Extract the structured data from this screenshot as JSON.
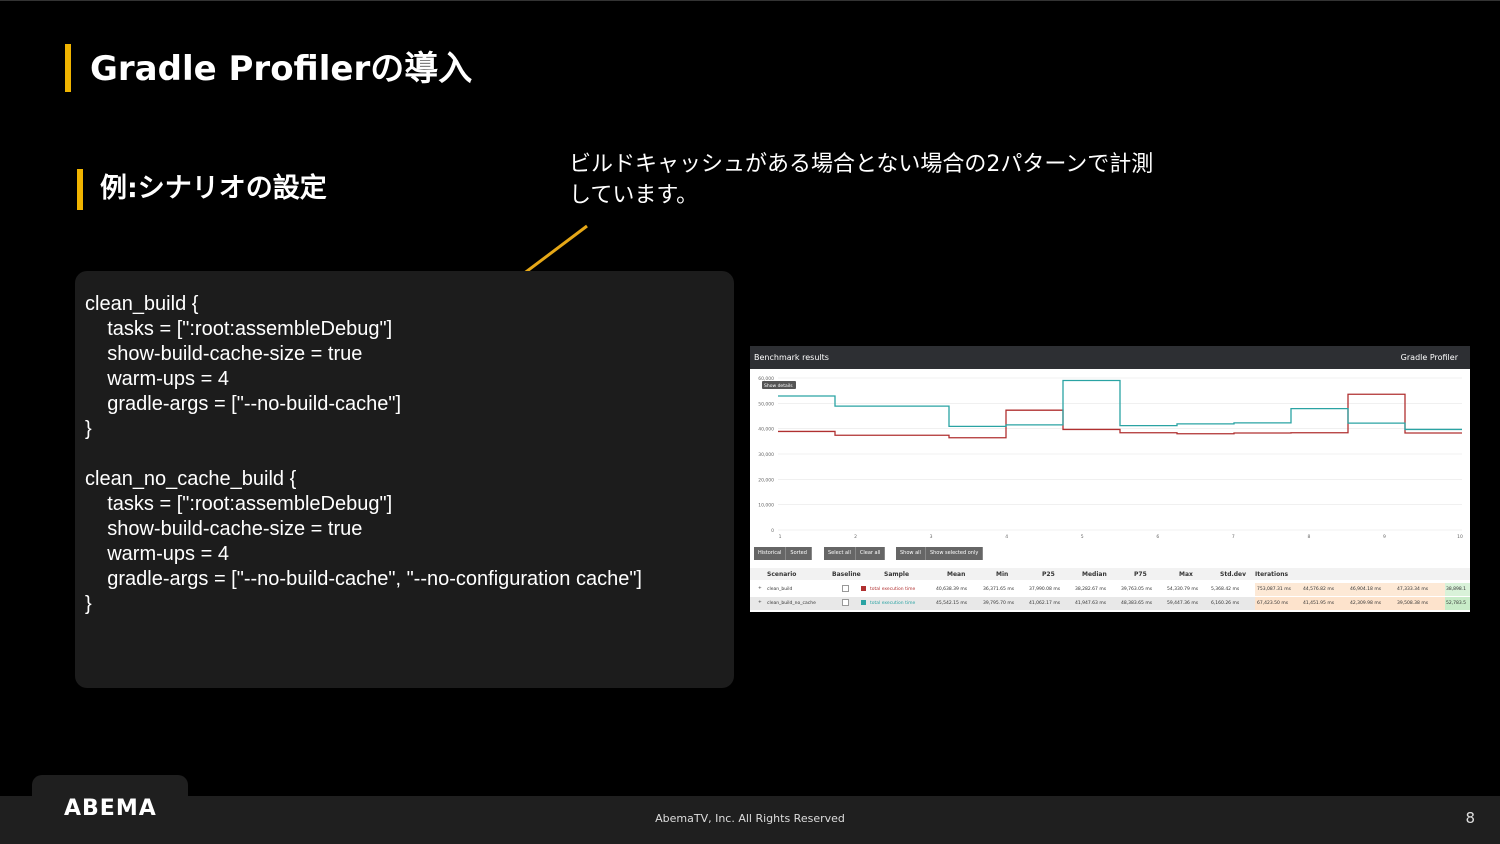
{
  "slide": {
    "title": "Gradle Profilerの導入",
    "subtitle": "例:シナリオの設定",
    "annotation": "ビルドキャッシュがある場合とない場合の2パターンで計測しています。",
    "code": "clean_build {\n    tasks = [\":root:assembleDebug\"]\n    show-build-cache-size = true\n    warm-ups = 4\n    gradle-args = [\"--no-build-cache\"]\n}\n\nclean_no_cache_build {\n    tasks = [\":root:assembleDebug\"]\n    show-build-cache-size = true\n    warm-ups = 4\n    gradle-args = [\"--no-build-cache\", \"--no-configuration cache\"]\n}",
    "accent_color": "#f0b400",
    "arrow_color": "#e6a817"
  },
  "benchmark": {
    "header_left": "Benchmark results",
    "header_right": "Gradle Profiler",
    "show_details": "Show details",
    "buttons": [
      "Historical",
      "Sorted",
      "Select all",
      "Clear all",
      "Show all",
      "Show selected only"
    ],
    "columns": [
      "Scenario",
      "Baseline",
      "Sample",
      "Mean",
      "Min",
      "P25",
      "Median",
      "P75",
      "Max",
      "Std.dev",
      "Iterations"
    ],
    "rows": [
      {
        "scenario": "clean_build",
        "sample": "total execution time",
        "mean": "40,638.39 ms",
        "min": "36,371.65 ms",
        "p25": "37,990.08 ms",
        "median": "38,282.67 ms",
        "p75": "39,763.05 ms",
        "max": "54,330.79 ms",
        "stddev": "5,368.42 ms",
        "iterations": [
          "753,087.31 ms",
          "44,576.82 ms",
          "46,904.18 ms",
          "47,333.34 ms",
          "38,898.1"
        ]
      },
      {
        "scenario": "clean_build_no_cache",
        "sample": "total execution time",
        "mean": "45,542.15 ms",
        "min": "39,795.70 ms",
        "p25": "41,062.17 ms",
        "median": "41,947.63 ms",
        "p75": "48,383.65 ms",
        "max": "59,447.36 ms",
        "stddev": "6,160.26 ms",
        "iterations": [
          "67,423.50 ms",
          "41,451.95 ms",
          "42,309.98 ms",
          "39,508.38 ms",
          "52,783.5"
        ]
      }
    ]
  },
  "chart_data": {
    "type": "line",
    "x": [
      1,
      2,
      3,
      4,
      5,
      6,
      7,
      8,
      9,
      10
    ],
    "y_ticks": [
      "60,000",
      "50,000",
      "40,000",
      "30,000",
      "20,000",
      "10,000",
      "0"
    ],
    "ylim": [
      0,
      60000
    ],
    "series": [
      {
        "name": "clean_build",
        "color": "#b03030",
        "values": [
          38900,
          37400,
          37400,
          36400,
          47300,
          39700,
          38400,
          38000,
          38300,
          38400,
          53600,
          38300
        ]
      },
      {
        "name": "clean_build_no_cache",
        "color": "#2aa3a3",
        "values": [
          52900,
          48900,
          48900,
          40900,
          41500,
          59000,
          41200,
          41900,
          42300,
          47900,
          42200,
          39700
        ]
      }
    ]
  },
  "footer": {
    "logo": "ABEMA",
    "copyright": "AbemaTV, Inc. All Rights Reserved",
    "page": "8"
  }
}
